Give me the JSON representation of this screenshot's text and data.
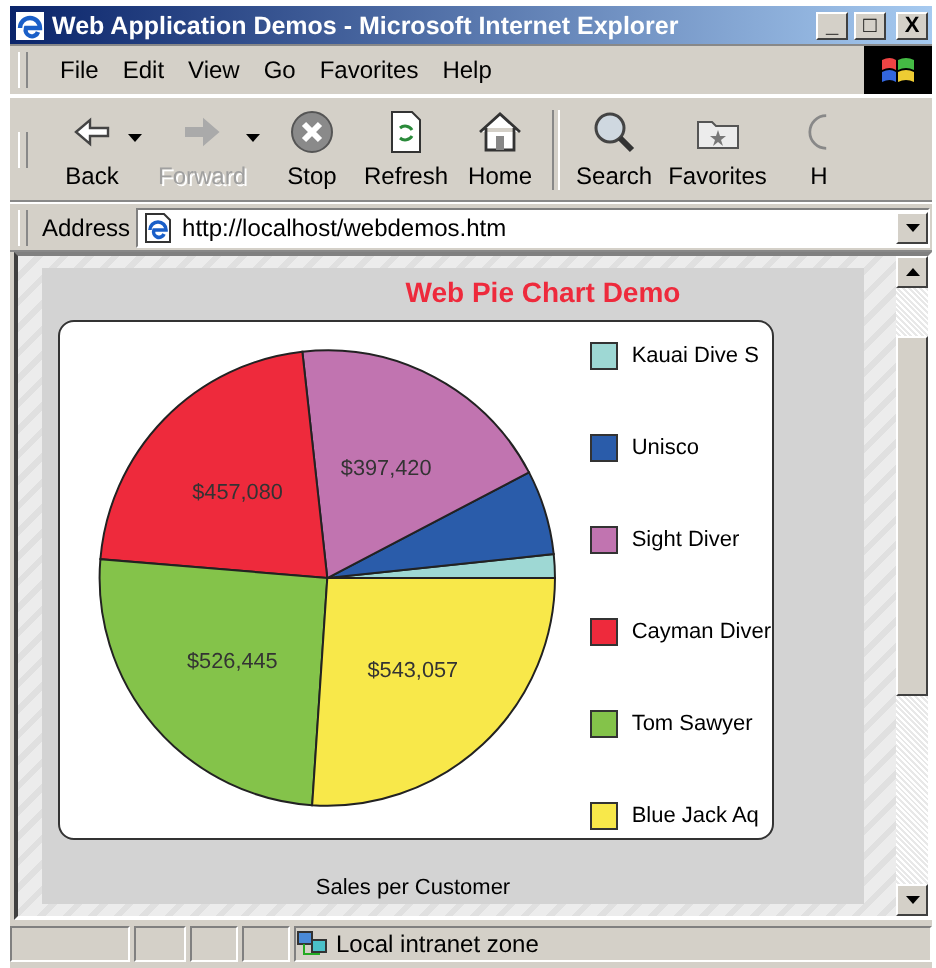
{
  "window": {
    "title": "Web Application Demos - Microsoft Internet Explorer",
    "controls": [
      "_",
      "□",
      "X"
    ]
  },
  "menu": [
    {
      "label": "File"
    },
    {
      "label": "Edit"
    },
    {
      "label": "View"
    },
    {
      "label": "Go"
    },
    {
      "label": "Favorites"
    },
    {
      "label": "Help"
    }
  ],
  "toolbar": [
    {
      "label": "Back",
      "disabled": false,
      "dropdown": true
    },
    {
      "label": "Forward",
      "disabled": true,
      "dropdown": true
    },
    {
      "label": "Stop",
      "disabled": false,
      "dropdown": false
    },
    {
      "label": "Refresh",
      "disabled": false,
      "dropdown": false
    },
    {
      "label": "Home",
      "disabled": false,
      "dropdown": false
    },
    {
      "label": "Search",
      "disabled": false,
      "dropdown": false
    },
    {
      "label": "Favorites",
      "disabled": false,
      "dropdown": false
    },
    {
      "label": "H",
      "disabled": false,
      "dropdown": false
    }
  ],
  "address": {
    "label": "Address",
    "value": "http://localhost/webdemos.htm"
  },
  "page": {
    "chart_data": {
      "type": "pie",
      "title": "Web Pie Chart Demo",
      "xlabel": "Sales per Customer",
      "legend": "right",
      "categories": [
        "Kauai Dive S",
        "Unisco",
        "Sight Diver",
        "Cayman Diver",
        "Tom Sawyer",
        "Blue Jack Aq"
      ],
      "colors": [
        "#9ed8d4",
        "#2a5caa",
        "#c174b0",
        "#ee2a3c",
        "#84c34a",
        "#f8e84a"
      ],
      "values": [
        35000,
        125000,
        397420,
        457080,
        526445,
        543057
      ],
      "value_labels": [
        null,
        null,
        "$397,420",
        "$457,080",
        "$526,445",
        "$543,057"
      ]
    }
  },
  "status_bar": {
    "zone": "Local intranet zone"
  }
}
